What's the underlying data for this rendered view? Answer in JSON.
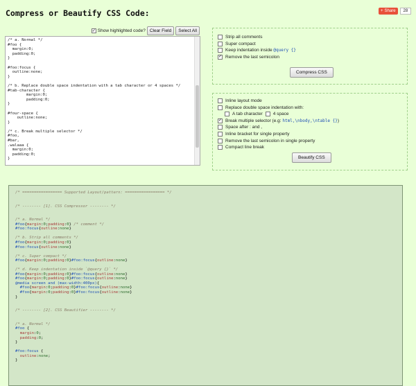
{
  "page": {
    "title": "Compress or Beautify CSS Code:"
  },
  "share": {
    "label": "Share",
    "count": "28",
    "icon": "plus-icon",
    "color": "#e8503a"
  },
  "toolbar": {
    "show_highlighted_label": "Show highlighted code?",
    "show_highlighted_checked": true,
    "clear_label": "Clear Field",
    "select_all_label": "Select All"
  },
  "editor": {
    "content": "/* a. Normal */\n#foo {\n  margin:0;\n  padding:0;\n}\n\n#foo:focus {\n  outline:none;\n}\n\n/* b. Replace double space indentation with a tab character or 4 spaces */\n#tab-character {\n        margin:0;\n        padding:0;\n}\n\n#four-space {\n    outline:none;\n}\n\n/* c. Break multiple selector */\n#foo,\n#bar,\n.walaaa {\n  margin:0;\n  padding:0;\n}"
  },
  "compress": {
    "options": [
      {
        "label": "Strip all comments",
        "checked": false
      },
      {
        "label": "Super compact",
        "checked": false
      },
      {
        "label": "Keep indentation inside ",
        "code": "@query {}",
        "checked": false
      },
      {
        "label": "Remove the last semicolon",
        "checked": true
      }
    ],
    "button_label": "Compress CSS"
  },
  "beautify": {
    "options": {
      "inline_layout": {
        "label": "Inline layout mode",
        "checked": false
      },
      "replace_indent": {
        "label": "Replace double space indentation with:",
        "checked": false
      },
      "tab_character": {
        "label": "A tab character",
        "checked": false
      },
      "four_space": {
        "label": "4 space",
        "checked": false
      },
      "break_selector": {
        "label": "Break multiple selector (e.g: ",
        "code": "html,\\nbody,\\ntable {}",
        "suffix": ")",
        "checked": true
      },
      "space_after": {
        "label": "Space after : and ,",
        "checked": false
      },
      "inline_bracket": {
        "label": "Inline bracket for single property",
        "checked": false
      },
      "remove_semicolon": {
        "label": "Remove the last semicolon in single property",
        "checked": false
      },
      "compact_break": {
        "label": "Compact line break",
        "checked": false
      }
    },
    "button_label": "Beautify CSS"
  },
  "output": {
    "background": "#d3e6c8"
  }
}
